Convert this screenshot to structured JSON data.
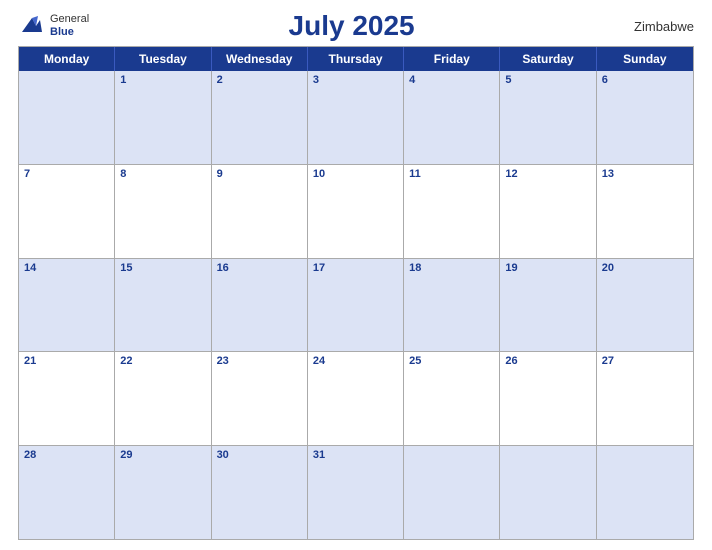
{
  "header": {
    "logo_general": "General",
    "logo_blue": "Blue",
    "month_title": "July 2025",
    "country": "Zimbabwe"
  },
  "days_of_week": [
    "Monday",
    "Tuesday",
    "Wednesday",
    "Thursday",
    "Friday",
    "Saturday",
    "Sunday"
  ],
  "weeks": [
    [
      {
        "num": "",
        "empty": true
      },
      {
        "num": "1"
      },
      {
        "num": "2"
      },
      {
        "num": "3"
      },
      {
        "num": "4"
      },
      {
        "num": "5"
      },
      {
        "num": "6"
      }
    ],
    [
      {
        "num": "7"
      },
      {
        "num": "8"
      },
      {
        "num": "9"
      },
      {
        "num": "10"
      },
      {
        "num": "11"
      },
      {
        "num": "12"
      },
      {
        "num": "13"
      }
    ],
    [
      {
        "num": "14"
      },
      {
        "num": "15"
      },
      {
        "num": "16"
      },
      {
        "num": "17"
      },
      {
        "num": "18"
      },
      {
        "num": "19"
      },
      {
        "num": "20"
      }
    ],
    [
      {
        "num": "21"
      },
      {
        "num": "22"
      },
      {
        "num": "23"
      },
      {
        "num": "24"
      },
      {
        "num": "25"
      },
      {
        "num": "26"
      },
      {
        "num": "27"
      }
    ],
    [
      {
        "num": "28"
      },
      {
        "num": "29"
      },
      {
        "num": "30"
      },
      {
        "num": "31"
      },
      {
        "num": "",
        "empty": true
      },
      {
        "num": "",
        "empty": true
      },
      {
        "num": "",
        "empty": true
      }
    ]
  ],
  "colors": {
    "header_bg": "#1a3a8f",
    "row_blue": "#dce3f5",
    "row_white": "#ffffff"
  }
}
